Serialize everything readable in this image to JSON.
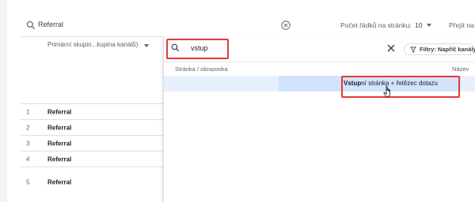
{
  "search": {
    "value": "Referral"
  },
  "pagination": {
    "rows_label": "Počet řádků na stránku:",
    "rows_value": "10",
    "goto_label": "Přejít na:"
  },
  "table": {
    "column_header": "Primární skupin...kupina kanálů)",
    "rows": [
      {
        "num": "1",
        "value": "Referral"
      },
      {
        "num": "2",
        "value": "Referral"
      },
      {
        "num": "3",
        "value": "Referral"
      },
      {
        "num": "4",
        "value": "Referral"
      },
      {
        "num": "5",
        "value": "Referral"
      }
    ]
  },
  "dimension_picker": {
    "search_value": "vstup",
    "filter_chip": "Filtry: Napříč kanály",
    "category_header": "Stránka / obrazovka",
    "name_header": "Název",
    "option_match": "Vstup",
    "option_rest": "ní stránka + řetězec dotazu"
  },
  "colors": {
    "highlight_box": "#e53935",
    "row_highlight": "#e8f0fe"
  }
}
